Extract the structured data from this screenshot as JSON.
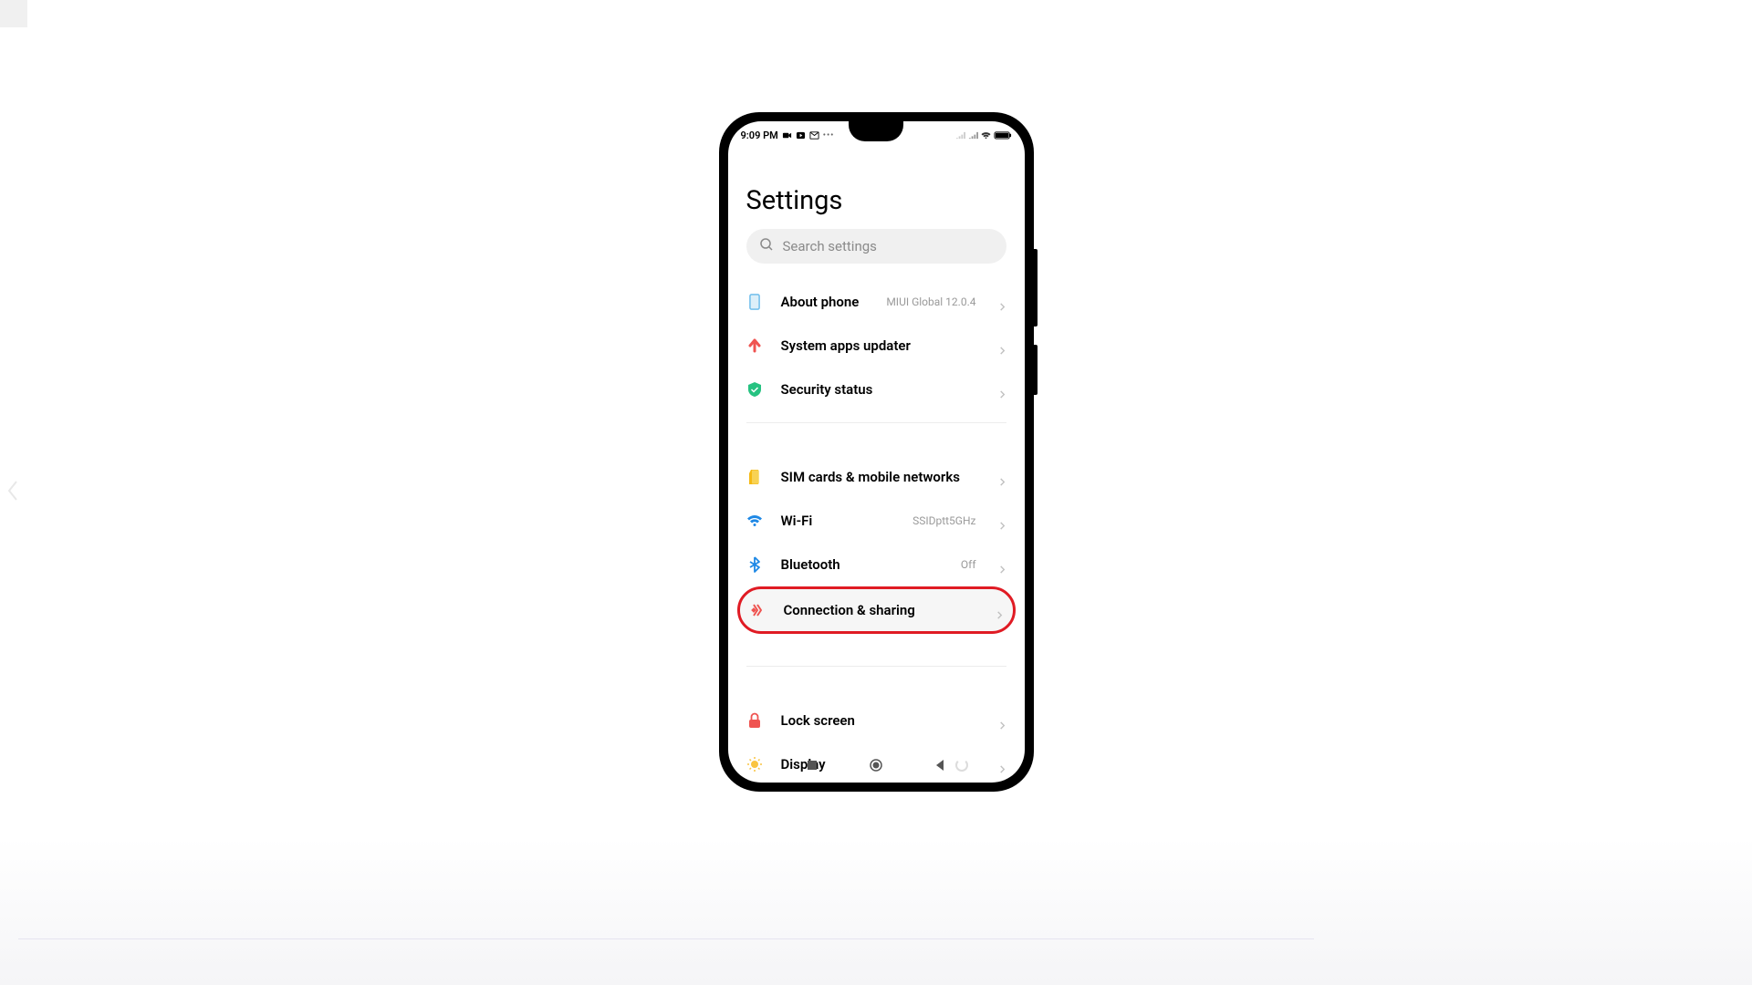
{
  "statusBar": {
    "time": "9:09 PM"
  },
  "page": {
    "title": "Settings"
  },
  "search": {
    "placeholder": "Search settings"
  },
  "groups": [
    {
      "items": [
        {
          "id": "about-phone",
          "label": "About phone",
          "secondary": "MIUI Global 12.0.4",
          "iconColor": "#5fb6ea",
          "iconType": "phone"
        },
        {
          "id": "system-apps-updater",
          "label": "System apps updater",
          "secondary": "",
          "iconColor": "#ef5350",
          "iconType": "upload"
        },
        {
          "id": "security-status",
          "label": "Security status",
          "secondary": "",
          "iconColor": "#26c281",
          "iconType": "shield"
        }
      ]
    },
    {
      "items": [
        {
          "id": "sim-cards",
          "label": "SIM cards & mobile networks",
          "secondary": "",
          "iconColor": "#f5b914",
          "iconType": "sim"
        },
        {
          "id": "wifi",
          "label": "Wi-Fi",
          "secondary": "SSIDptt5GHz",
          "iconColor": "#1e88e5",
          "iconType": "wifi"
        },
        {
          "id": "bluetooth",
          "label": "Bluetooth",
          "secondary": "Off",
          "iconColor": "#1e88e5",
          "iconType": "bluetooth"
        },
        {
          "id": "connection-sharing",
          "label": "Connection & sharing",
          "secondary": "",
          "iconColor": "#ef5350",
          "iconType": "share",
          "highlighted": true
        }
      ]
    },
    {
      "items": [
        {
          "id": "lock-screen",
          "label": "Lock screen",
          "secondary": "",
          "iconColor": "#ef5350",
          "iconType": "lock"
        },
        {
          "id": "display",
          "label": "Display",
          "secondary": "",
          "iconColor": "#f9c440",
          "iconType": "brightness"
        }
      ]
    }
  ]
}
